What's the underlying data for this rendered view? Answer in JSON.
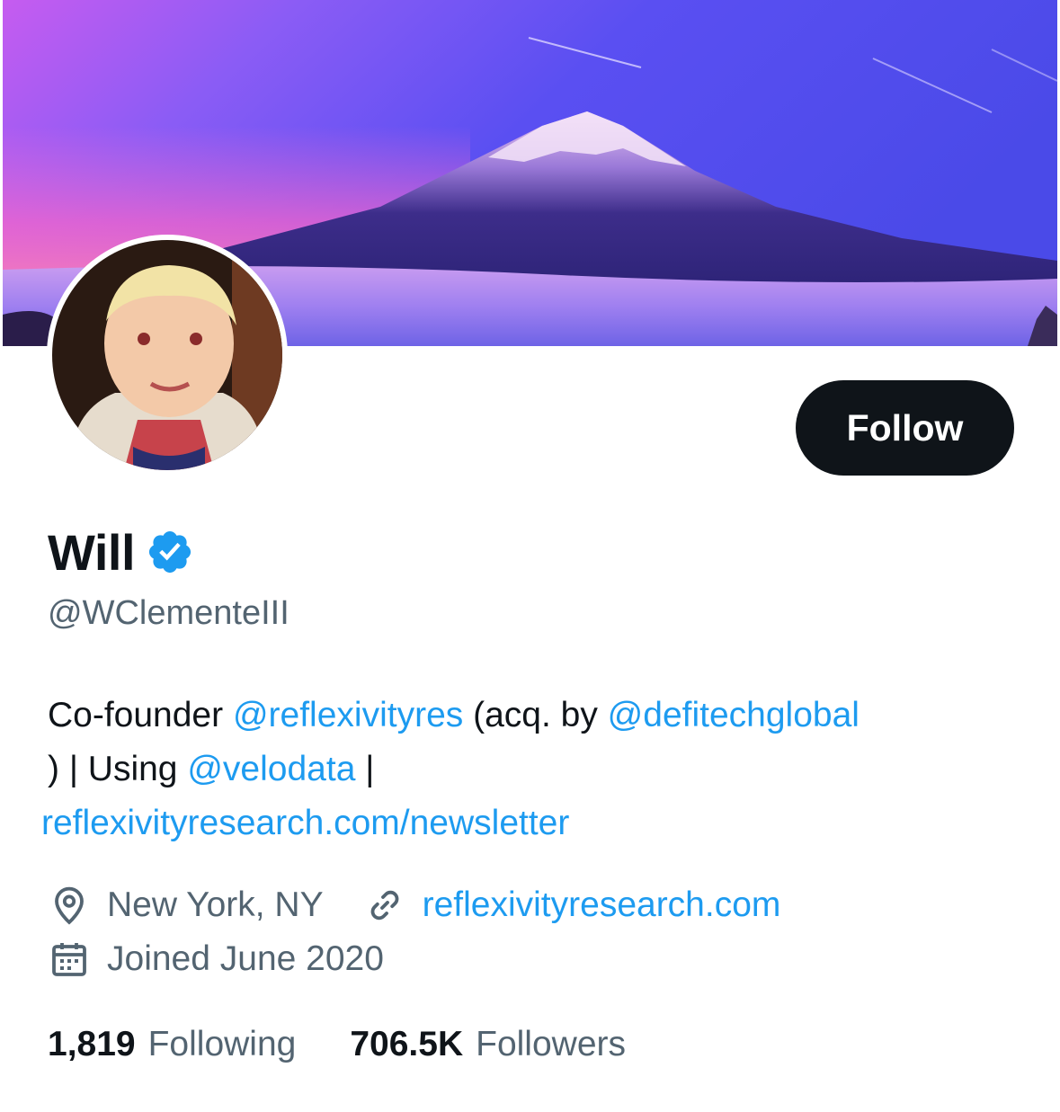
{
  "profile": {
    "name": "Will",
    "handle": "@WClementeIII",
    "verified_color": "#1d9bf0",
    "follow_label": "Follow",
    "bio": {
      "line1_text": "Co-founder ",
      "mention1": "@reflexivityres",
      "line1_mid": " (acq. by ",
      "mention2": "@defitechglobal",
      "line2_start": ") | Using ",
      "mention3": "@velodata",
      "line2_end": " |",
      "url": "reflexivityresearch.com/newsletter"
    },
    "location": "New York, NY",
    "website": "reflexivityresearch.com",
    "joined": "Joined June 2020",
    "following_count": "1,819",
    "following_label": "Following",
    "followers_count": "706.5K",
    "followers_label": "Followers"
  },
  "icons": {
    "location": "location-pin-icon",
    "link": "link-icon",
    "calendar": "calendar-icon",
    "verified": "verified-badge-icon"
  },
  "colors": {
    "link": "#1d9bf0",
    "text": "#0f1419",
    "secondary": "#536471",
    "button_bg": "#0f1419"
  }
}
